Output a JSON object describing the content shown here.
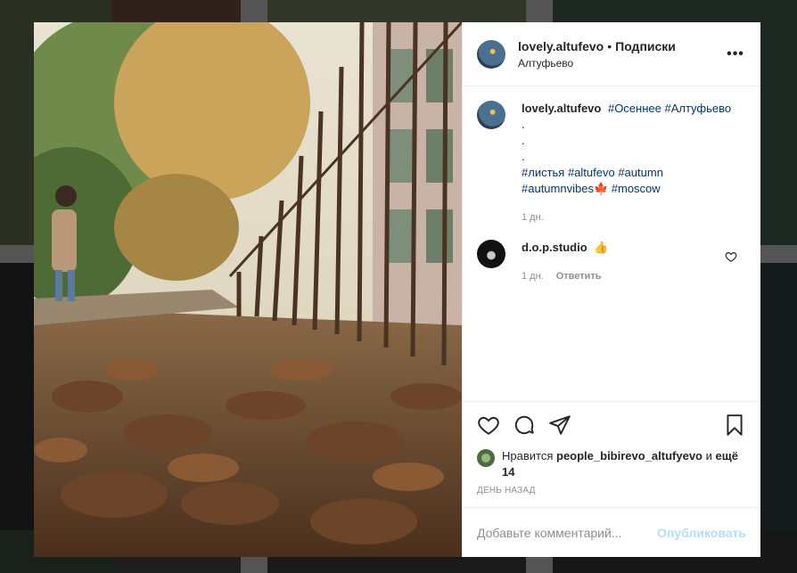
{
  "post": {
    "author": "lovely.altufevo",
    "follow_sep": "•",
    "follow_label": "Подписки",
    "location": "Алтуфьево",
    "more_label": "•••"
  },
  "caption": {
    "author": "lovely.altufevo",
    "line1_tags": "#Осеннее #Алтуфьево",
    "dot1": ".",
    "dot2": ".",
    "dot3": ".",
    "line2_tags": "#листья #altufevo #autumn",
    "line3_tags_a": "#autumnvibes",
    "line3_emoji": "🍁",
    "line3_tags_b": "#moscow",
    "time": "1 дн."
  },
  "comment": {
    "author": "d.o.p.studio",
    "emoji": "👍",
    "time": "1 дн.",
    "reply_label": "Ответить"
  },
  "likes": {
    "prefix": "Нравится",
    "user": "people_bibirevo_altufyevo",
    "joiner": "и",
    "more": "ещё 14"
  },
  "date_label": "ДЕНЬ НАЗАД",
  "add_comment": {
    "placeholder": "Добавьте комментарий...",
    "post_label": "Опубликовать"
  },
  "colors": {
    "hashtag": "#00376b",
    "post_button": "#b2dffc",
    "meta": "#8e8e8e"
  }
}
